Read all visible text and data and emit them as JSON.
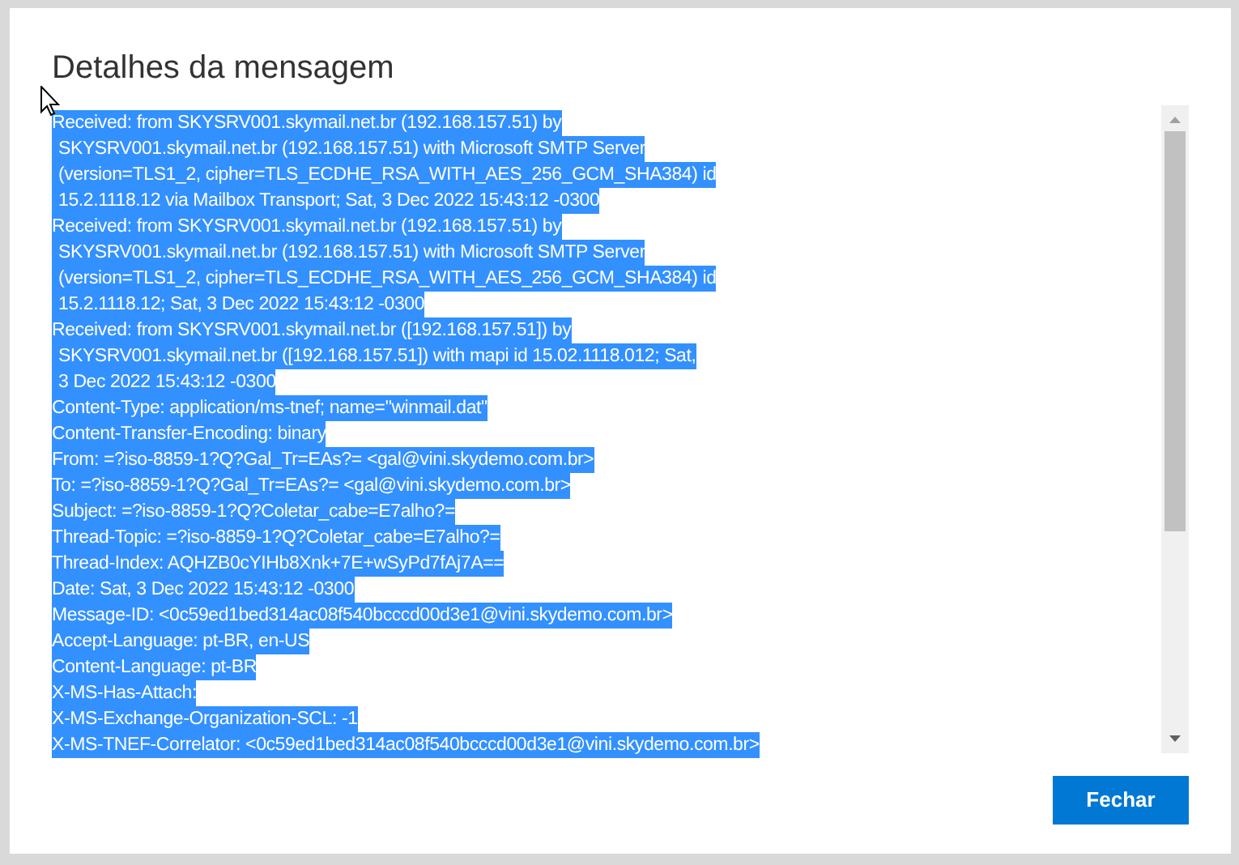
{
  "dialog": {
    "title": "Detalhes da mensagem",
    "headers": {
      "selected": true,
      "lines": [
        {
          "kind": "first",
          "text": "Received: from SKYSRV001.skymail.net.br (192.168.157.51) by"
        },
        {
          "kind": "continued",
          "text": "SKYSRV001.skymail.net.br (192.168.157.51) with Microsoft SMTP Server"
        },
        {
          "kind": "continued",
          "text": "(version=TLS1_2, cipher=TLS_ECDHE_RSA_WITH_AES_256_GCM_SHA384) id"
        },
        {
          "kind": "continued",
          "text": "15.2.1118.12 via Mailbox Transport; Sat, 3 Dec 2022 15:43:12 -0300"
        },
        {
          "kind": "first",
          "text": "Received: from SKYSRV001.skymail.net.br (192.168.157.51) by"
        },
        {
          "kind": "continued",
          "text": "SKYSRV001.skymail.net.br (192.168.157.51) with Microsoft SMTP Server"
        },
        {
          "kind": "continued",
          "text": "(version=TLS1_2, cipher=TLS_ECDHE_RSA_WITH_AES_256_GCM_SHA384) id"
        },
        {
          "kind": "continued",
          "text": "15.2.1118.12; Sat, 3 Dec 2022 15:43:12 -0300"
        },
        {
          "kind": "first",
          "text": "Received: from SKYSRV001.skymail.net.br ([192.168.157.51]) by"
        },
        {
          "kind": "continued",
          "text": "SKYSRV001.skymail.net.br ([192.168.157.51]) with mapi id 15.02.1118.012; Sat,"
        },
        {
          "kind": "continued",
          "text": "3 Dec 2022 15:43:12 -0300"
        },
        {
          "kind": "first",
          "text": "Content-Type: application/ms-tnef; name=\"winmail.dat\""
        },
        {
          "kind": "first",
          "text": "Content-Transfer-Encoding: binary"
        },
        {
          "kind": "first",
          "text": "From: =?iso-8859-1?Q?Gal_Tr=EAs?= <gal@vini.skydemo.com.br>"
        },
        {
          "kind": "first",
          "text": "To: =?iso-8859-1?Q?Gal_Tr=EAs?= <gal@vini.skydemo.com.br>"
        },
        {
          "kind": "first",
          "text": "Subject: =?iso-8859-1?Q?Coletar_cabe=E7alho?="
        },
        {
          "kind": "first",
          "text": "Thread-Topic: =?iso-8859-1?Q?Coletar_cabe=E7alho?="
        },
        {
          "kind": "first",
          "text": "Thread-Index: AQHZB0cYIHb8Xnk+7E+wSyPd7fAj7A=="
        },
        {
          "kind": "first",
          "text": "Date: Sat, 3 Dec 2022 15:43:12 -0300"
        },
        {
          "kind": "first",
          "text": "Message-ID: <0c59ed1bed314ac08f540bcccd00d3e1@vini.skydemo.com.br>"
        },
        {
          "kind": "first",
          "text": "Accept-Language: pt-BR, en-US"
        },
        {
          "kind": "first",
          "text": "Content-Language: pt-BR"
        },
        {
          "kind": "first",
          "text": "X-MS-Has-Attach:"
        },
        {
          "kind": "first",
          "text": "X-MS-Exchange-Organization-SCL: -1"
        },
        {
          "kind": "first",
          "text": "X-MS-TNEF-Correlator: <0c59ed1bed314ac08f540bcccd00d3e1@vini.skydemo.com.br>"
        }
      ]
    },
    "buttons": [
      {
        "label": "Fechar"
      }
    ]
  }
}
